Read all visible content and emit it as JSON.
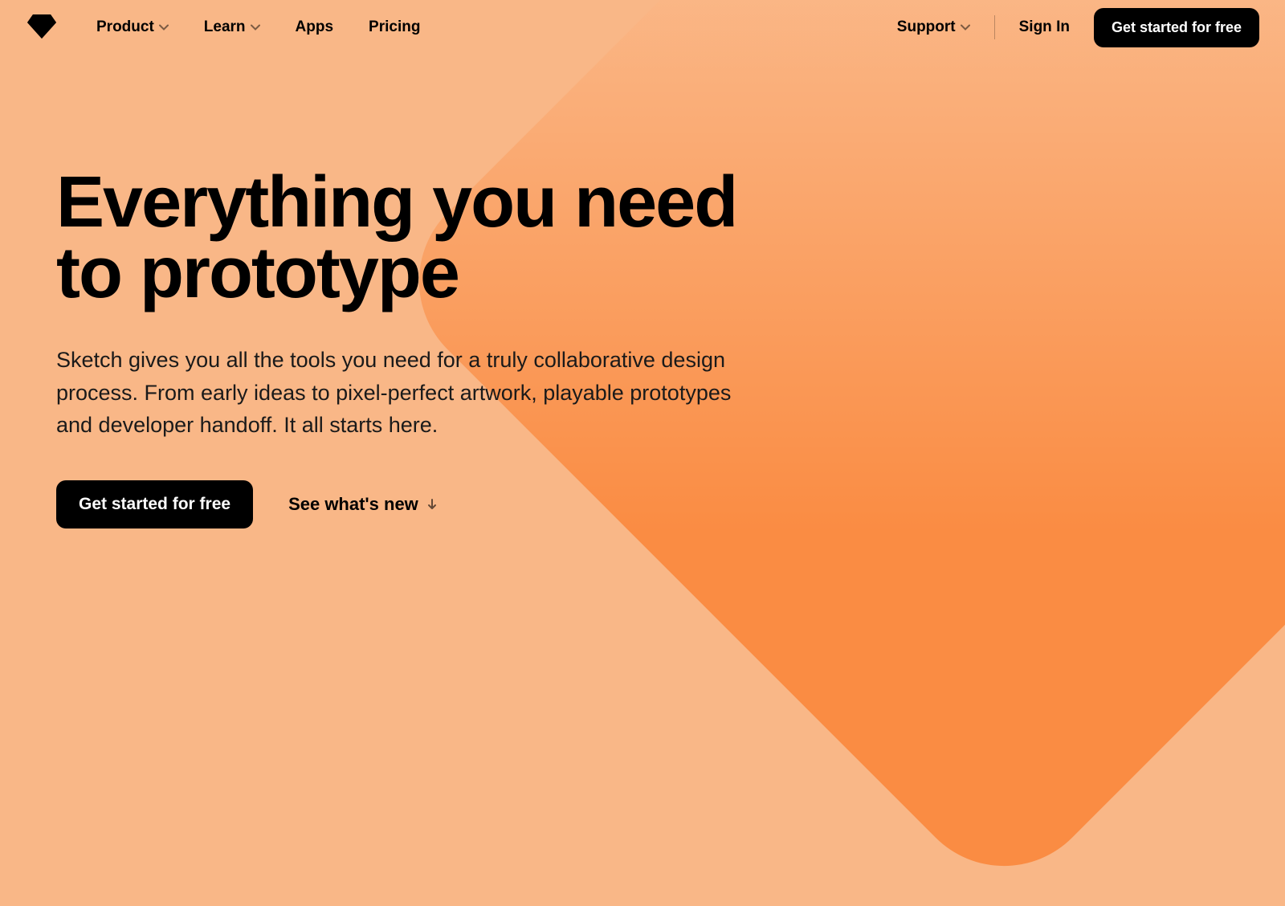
{
  "nav": {
    "items": [
      {
        "label": "Product",
        "hasDropdown": true
      },
      {
        "label": "Learn",
        "hasDropdown": true
      },
      {
        "label": "Apps",
        "hasDropdown": false
      },
      {
        "label": "Pricing",
        "hasDropdown": false
      }
    ],
    "support": "Support",
    "signIn": "Sign In",
    "cta": "Get started for free"
  },
  "hero": {
    "headline": "Everything you need to prototype",
    "body": "Sketch gives you all the tools you need for a truly collaborative design process. From early ideas to pixel-perfect artwork, playable prototypes and developer handoff. It all starts here.",
    "cta": "Get started for free",
    "secondary": "See what's new"
  }
}
